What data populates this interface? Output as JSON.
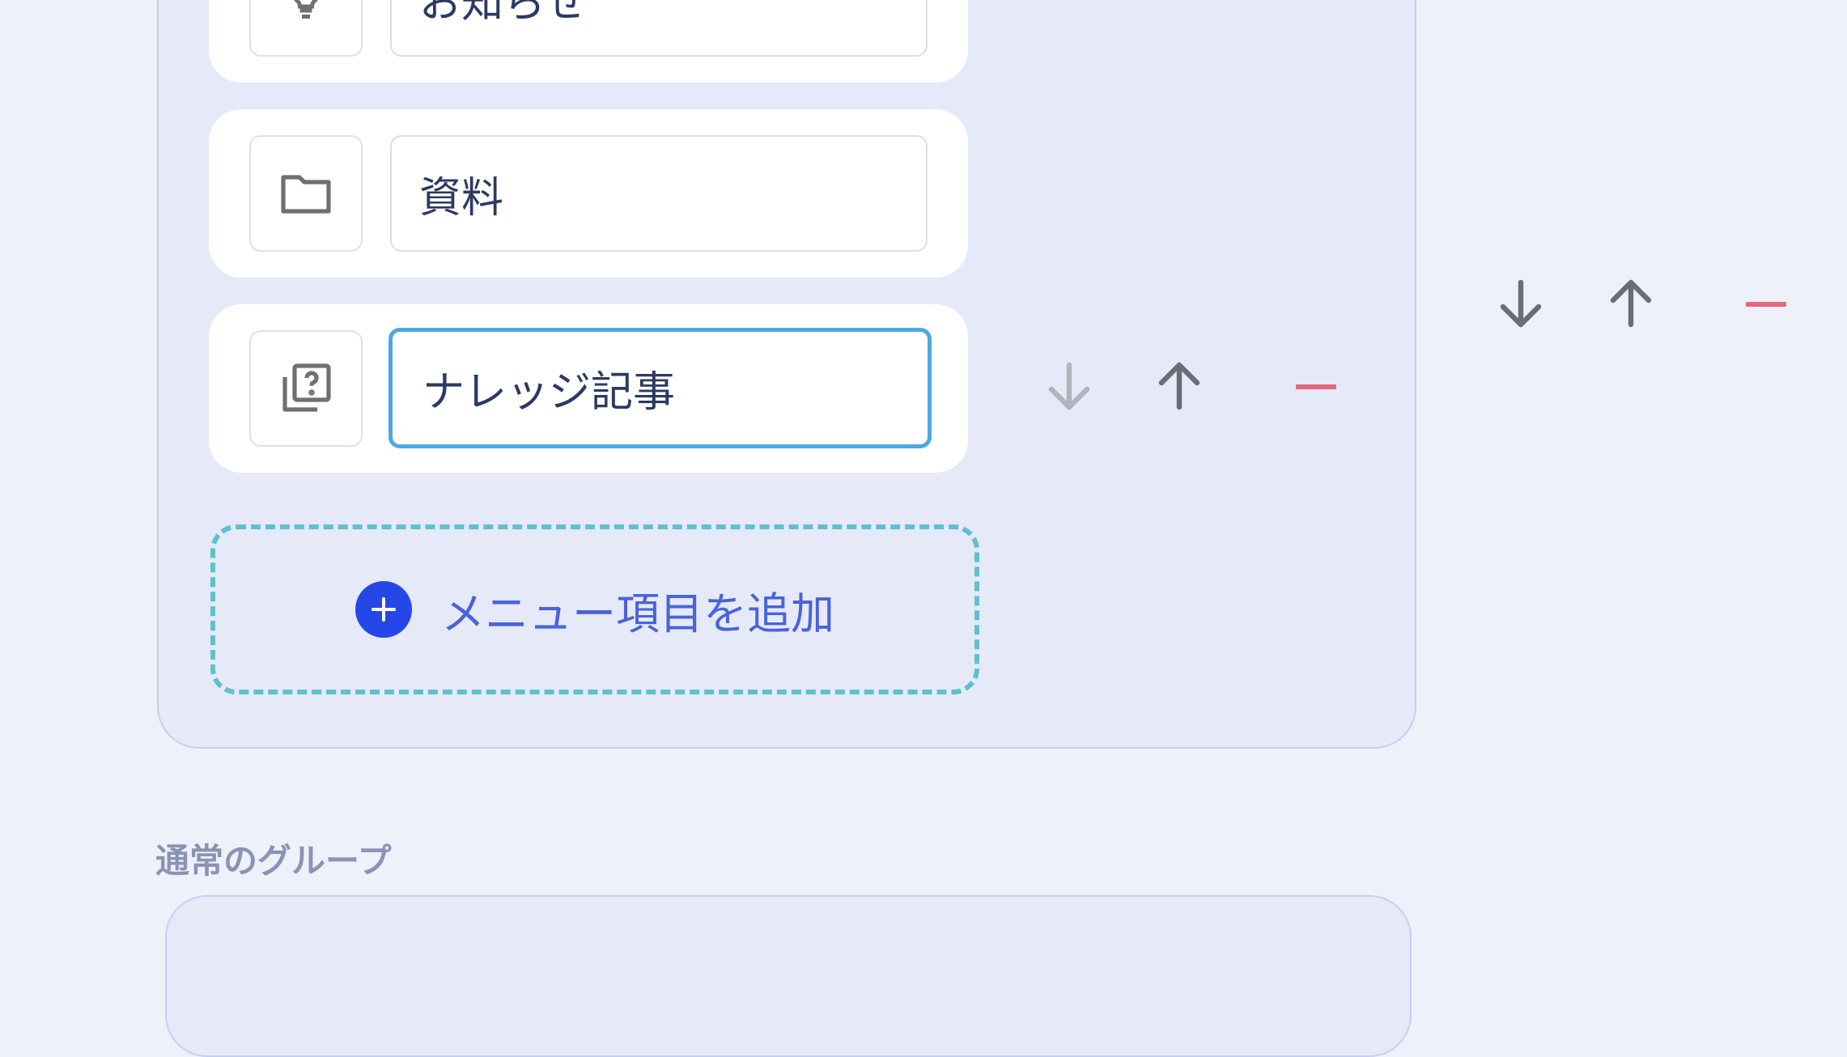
{
  "menu_items": [
    {
      "label": "お知らせ",
      "icon": "lightbulb-icon"
    },
    {
      "label": "資料",
      "icon": "folder-icon"
    },
    {
      "label": "ナレッジ記事",
      "icon": "knowledge-question-icon"
    }
  ],
  "add_item_label": "メニュー項目を追加",
  "normal_group_heading": "通常のグループ",
  "colors": {
    "accent": "#2547e8",
    "focus_border": "#4ea8e0",
    "delete": "#e5677a",
    "dashed_border": "#5fc0cf",
    "panel_bg": "#e5e9f8"
  }
}
